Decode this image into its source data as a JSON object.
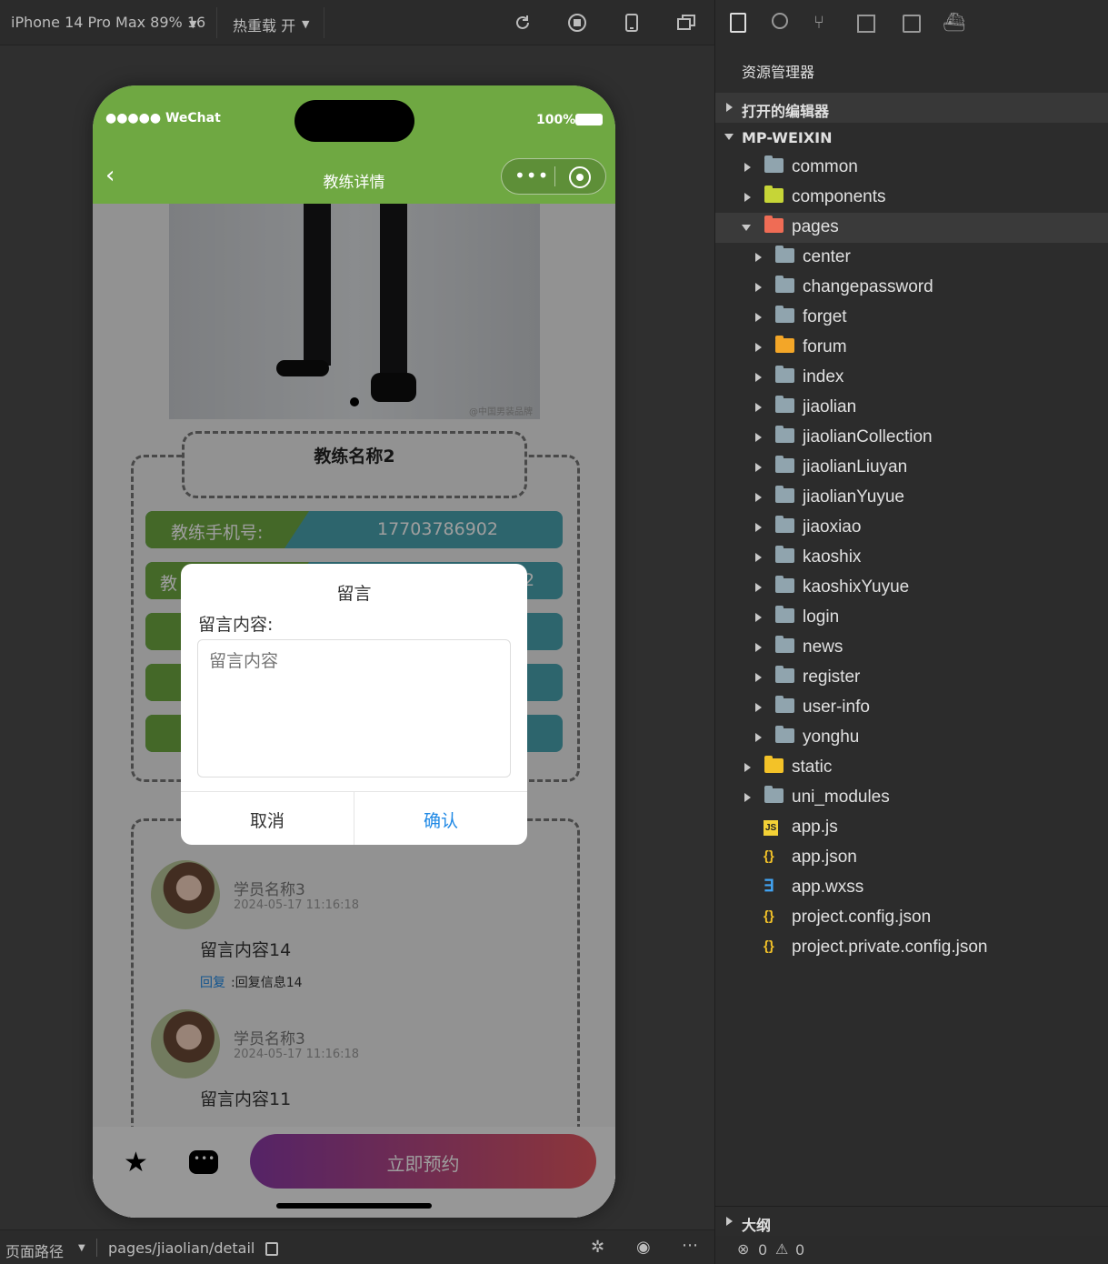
{
  "toolbar": {
    "device": "iPhone 14 Pro Max 89% 16",
    "hot_reload": "热重载 开"
  },
  "phone": {
    "status": {
      "carrier": "●●●●● WeChat",
      "battery": "100%"
    },
    "nav": {
      "title": "教练详情"
    },
    "coach": {
      "name": "教练名称2",
      "phone_label": "教练手机号:",
      "phone_value": "17703786902",
      "row2_label": "教",
      "row2_value": "2"
    },
    "comments": [
      {
        "user": "学员名称3",
        "time": "2024-05-17 11:16:18",
        "content": "留言内容14",
        "reply_label": "回复",
        "reply_text": ":回复信息14"
      },
      {
        "user": "学员名称3",
        "time": "2024-05-17 11:16:18",
        "content": "留言内容11"
      }
    ],
    "book_button": "立即预约",
    "watermark": "@中国男装品牌"
  },
  "dialog": {
    "title": "留言",
    "field_label": "留言内容:",
    "placeholder": "留言内容",
    "cancel": "取消",
    "confirm": "确认"
  },
  "bottom": {
    "path_label": "页面路径",
    "path": "pages/jiaolian/detail"
  },
  "panel": {
    "title": "资源管理器",
    "open_editors": "打开的编辑器",
    "project": "MP-WEIXIN",
    "items": [
      "common",
      "components",
      "pages",
      "center",
      "changepassword",
      "forget",
      "forum",
      "index",
      "jiaolian",
      "jiaolianCollection",
      "jiaolianLiuyan",
      "jiaolianYuyue",
      "jiaoxiao",
      "kaoshix",
      "kaoshixYuyue",
      "login",
      "news",
      "register",
      "user-info",
      "yonghu",
      "static",
      "uni_modules",
      "app.js",
      "app.json",
      "app.wxss",
      "project.config.json",
      "project.private.config.json"
    ],
    "outline": "大纲",
    "errors": "0",
    "warnings": "0"
  },
  "colors": {
    "nav_green": "#6fa842",
    "teal": "#4aa3b0",
    "folder": "#90a4ae",
    "accent_blue": "#1e88e5"
  }
}
